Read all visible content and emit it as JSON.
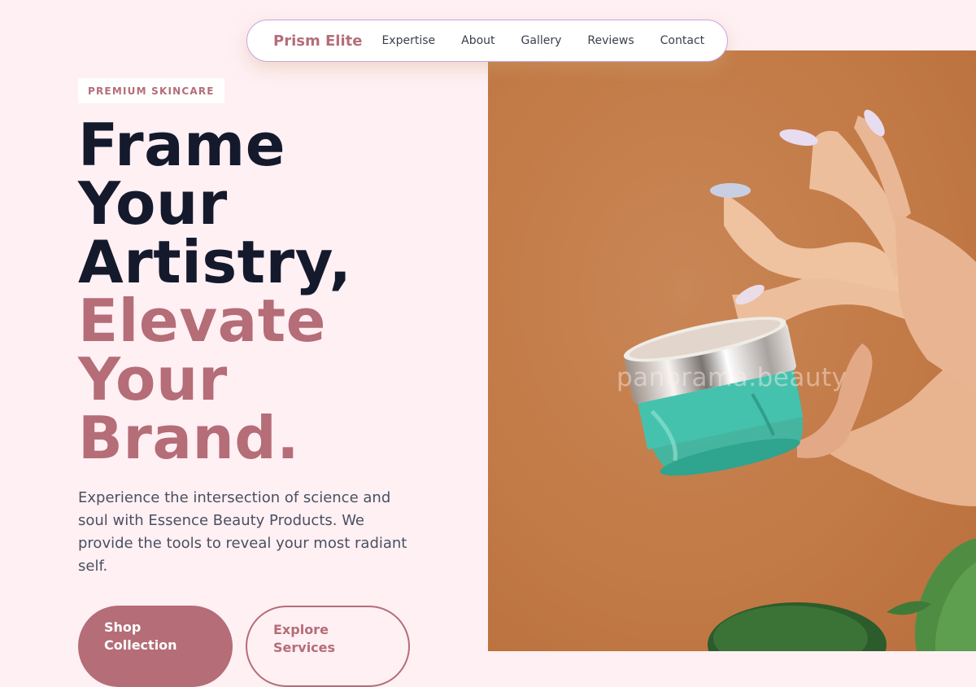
{
  "nav": {
    "brand": "Prism Elite",
    "links": [
      "Expertise",
      "About",
      "Gallery",
      "Reviews",
      "Contact"
    ]
  },
  "hero": {
    "badge": "PREMIUM SKINCARE",
    "headline_dark": [
      "Frame",
      "Your",
      "Artistry,"
    ],
    "headline_accent": [
      "Elevate",
      "Your",
      "Brand."
    ],
    "lead": "Experience the intersection of science and soul with Essence Beauty Products. We provide the tools to reveal your most radiant self.",
    "primary_button": [
      "Shop",
      "Collection"
    ],
    "secondary_button": [
      "Explore",
      "Services"
    ]
  },
  "image": {
    "watermark": "panorama.beauty"
  },
  "colors": {
    "page_background": "#fff0f4",
    "accent": "#b56d78",
    "heading": "#141a2c",
    "body_text": "#4a5060",
    "image_background": "#c27a46"
  }
}
